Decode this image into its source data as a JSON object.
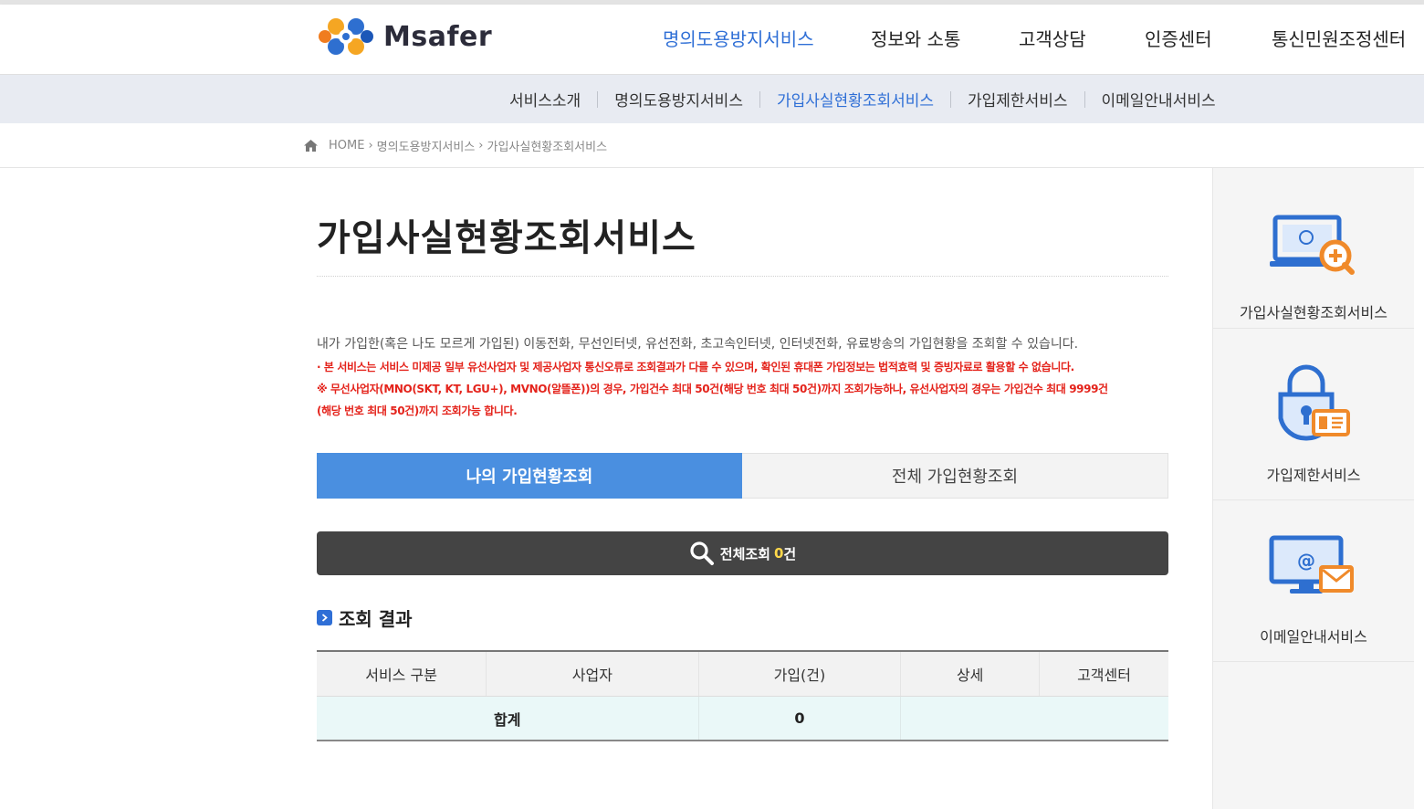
{
  "header": {
    "logo_text": "Msafer",
    "nav": [
      {
        "label": "명의도용방지서비스",
        "active": true
      },
      {
        "label": "정보와 소통",
        "active": false
      },
      {
        "label": "고객상담",
        "active": false
      },
      {
        "label": "인증센터",
        "active": false
      },
      {
        "label": "통신민원조정센터",
        "active": false
      }
    ]
  },
  "subnav": {
    "items": [
      {
        "label": "서비스소개"
      },
      {
        "label": "명의도용방지서비스"
      },
      {
        "label": "가입사실현황조회서비스"
      },
      {
        "label": "가입제한서비스"
      },
      {
        "label": "이메일안내서비스"
      }
    ],
    "active_index": 2
  },
  "breadcrumb": {
    "home": "HOME",
    "level1": "명의도용방지서비스",
    "level2": "가입사실현황조회서비스"
  },
  "page": {
    "title": "가입사실현황조회서비스",
    "description": "내가 가입한(혹은 나도 모르게 가입된) 이동전화, 무선인터넷, 유선전화, 초고속인터넷, 인터넷전화, 유료방송의 가입현황을 조회할 수 있습니다.",
    "notice_1": "· 본 서비스는 서비스 미제공 일부 유선사업자 및 제공사업자 통신오류로 조회결과가 다를 수 있으며, 확인된 휴대폰 가입정보는 법적효력 및 증빙자료로 활용할 수 없습니다.",
    "notice_2a": "※ 무선사업자(MNO(SKT, KT, LGU+), MVNO(알뜰폰))의 경우, 가입건수 최대 50건(해당 번호 최대 50건)까지 조회가능하나, 유선사업자의 경우는 가입건수 최대 9999건",
    "notice_2b": "(해당 번호 최대 50건)까지 조회가능 합니다."
  },
  "tabs": {
    "my": "나의 가입현황조회",
    "all": "전체 가입현황조회"
  },
  "search": {
    "label": "전체조회",
    "count": "0",
    "unit": "건"
  },
  "result": {
    "section_title": "조회 결과",
    "columns": [
      "서비스 구분",
      "사업자",
      "가입(건)",
      "상세",
      "고객센터"
    ],
    "total_label": "합계",
    "total_value": "0"
  },
  "sidebar": {
    "items": [
      {
        "label": "가입사실현황조회서비스",
        "icon": "laptop-search-icon"
      },
      {
        "label": "가입제한서비스",
        "icon": "lock-card-icon"
      },
      {
        "label": "이메일안내서비스",
        "icon": "monitor-email-icon"
      }
    ]
  },
  "colors": {
    "accent": "#2f6fd6",
    "tab_active": "#4a8fe0",
    "warning": "#e4231b",
    "search_bar": "#444444",
    "icon_orange": "#f08a2a"
  }
}
